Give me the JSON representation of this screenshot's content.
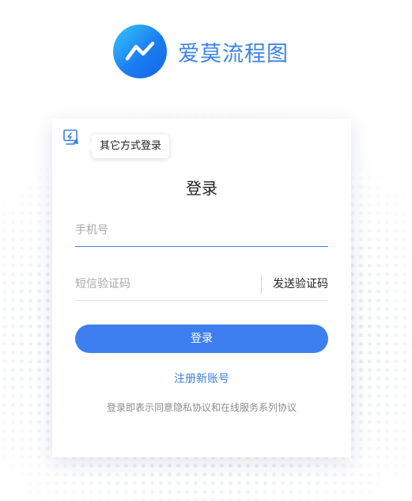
{
  "brand": {
    "name": "爱莫流程图",
    "logo_icon": "trend-line-icon",
    "color": "#3d83e6"
  },
  "login": {
    "alt_login_icon": "qr-scan-icon",
    "alt_login_tooltip": "其它方式登录",
    "title": "登录",
    "phone": {
      "placeholder": "手机号",
      "value": ""
    },
    "code": {
      "placeholder": "短信验证码",
      "value": ""
    },
    "send_code_label": "发送验证码",
    "submit_label": "登录",
    "register_label": "注册新账号",
    "agreement_text": "登录即表示同意隐私协议和在线服务系列协议",
    "accent_color": "#3d7ff0"
  }
}
